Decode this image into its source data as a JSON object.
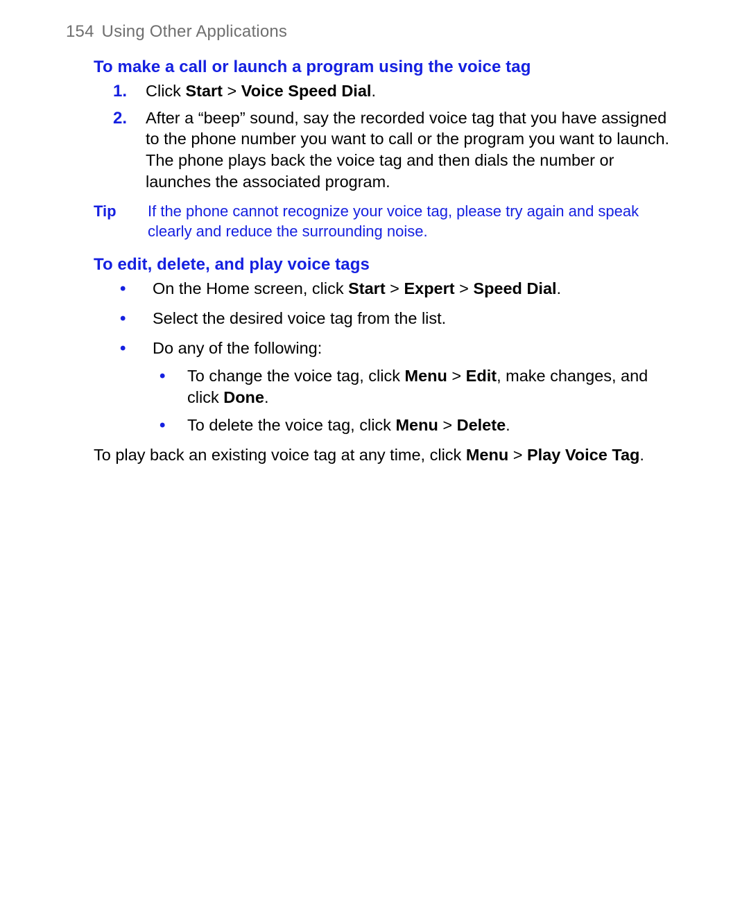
{
  "header": {
    "page_number": "154",
    "title": "Using Other Applications"
  },
  "section1": {
    "heading": "To make a call or launch a program using the voice tag",
    "steps": [
      {
        "num": "1",
        "pre": "Click ",
        "b1": "Start",
        "sep1": " > ",
        "b2": "Voice Speed Dial",
        "post": "."
      },
      {
        "num": "2",
        "full": "After a “beep” sound, say the recorded voice tag that you have assigned to the phone number you want to call or the program you want to launch. The phone plays back the voice tag and then dials the number or launches the associated program."
      }
    ]
  },
  "tip": {
    "label": "Tip",
    "body": "If the phone cannot recognize your voice tag, please try again and speak clearly and reduce the surrounding noise."
  },
  "section2": {
    "heading": "To edit, delete, and play voice tags",
    "bullets": {
      "b0": {
        "pre": "On the Home screen, click ",
        "s1": "Start",
        "sep1": " > ",
        "s2": "Expert",
        "sep2": " > ",
        "s3": "Speed Dial",
        "post": "."
      },
      "b1": {
        "text": "Select the desired voice tag from the list."
      },
      "b2": {
        "text": "Do any of the following:",
        "inner": {
          "i0": {
            "pre": "To change the voice tag, click ",
            "s1": "Menu",
            "sep1": " > ",
            "s2": "Edit",
            "mid": ", make changes, and click ",
            "s3": "Done",
            "post": "."
          },
          "i1": {
            "pre": "To delete the voice tag, click ",
            "s1": "Menu",
            "sep1": " > ",
            "s2": "Delete",
            "post": "."
          }
        }
      }
    }
  },
  "closing": {
    "pre": "To play back an existing voice tag at any time, click ",
    "s1": "Menu",
    "sep1": " > ",
    "s2": "Play Voice Tag",
    "post": "."
  }
}
